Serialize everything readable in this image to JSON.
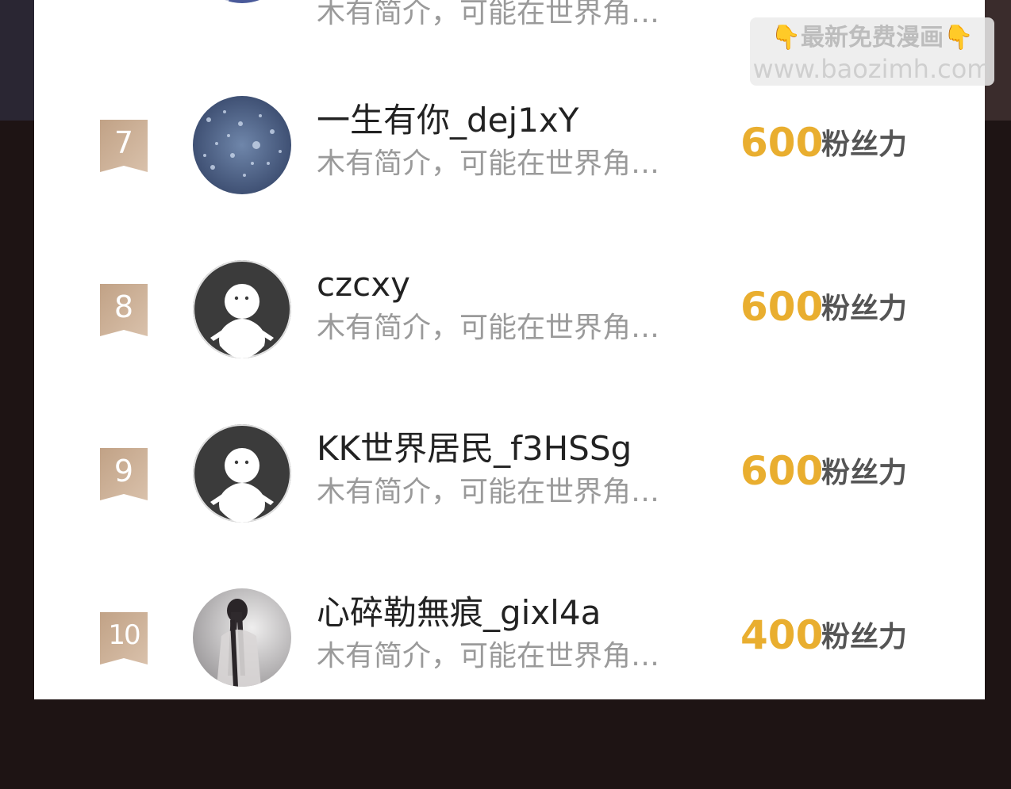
{
  "colors": {
    "rank_badge": "#c9ab90",
    "score": "#e9ae2f",
    "name": "#222222",
    "intro": "#9a9a9a",
    "panel": "#ffffff",
    "background": "#1e1414"
  },
  "watermark": {
    "line1_text": "最新免费漫画",
    "line1_icon": "pointing-down-hand-icon",
    "line2_text": "www.baozimh.com"
  },
  "partial_top_row": {
    "intro": "木有简介，可能在世界角…"
  },
  "ranking": [
    {
      "rank": "7",
      "name": "一生有你_dej1xY",
      "intro": "木有简介，可能在世界角…",
      "score": "600",
      "score_unit": "粉丝力",
      "avatar": "raindrops-photo"
    },
    {
      "rank": "8",
      "name": "czcxy",
      "intro": "木有简介，可能在世界角…",
      "score": "600",
      "score_unit": "粉丝力",
      "avatar": "default-avatar"
    },
    {
      "rank": "9",
      "name": "KK世界居民_f3HSSg",
      "intro": "木有简介，可能在世界角…",
      "score": "600",
      "score_unit": "粉丝力",
      "avatar": "default-avatar"
    },
    {
      "rank": "10",
      "name": "心碎勒無痕_gixl4a",
      "intro": "木有简介，可能在世界角…",
      "score": "400",
      "score_unit": "粉丝力",
      "avatar": "long-hair-figure-photo"
    }
  ]
}
